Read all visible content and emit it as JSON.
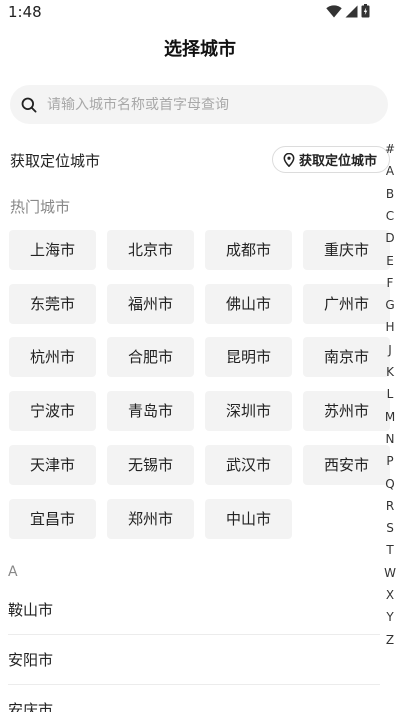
{
  "status_bar": {
    "time": "1:48"
  },
  "header": {
    "title": "选择城市"
  },
  "search": {
    "placeholder": "请输入城市名称或首字母查询"
  },
  "location": {
    "label": "获取定位城市",
    "button_label": "获取定位城市"
  },
  "hot_cities": {
    "label": "热门城市",
    "items": [
      "上海市",
      "北京市",
      "成都市",
      "重庆市",
      "东莞市",
      "福州市",
      "佛山市",
      "广州市",
      "杭州市",
      "合肥市",
      "昆明市",
      "南京市",
      "宁波市",
      "青岛市",
      "深圳市",
      "苏州市",
      "天津市",
      "无锡市",
      "武汉市",
      "西安市",
      "宜昌市",
      "郑州市",
      "中山市"
    ]
  },
  "city_groups": [
    {
      "letter": "A",
      "cities": [
        "鞍山市",
        "安阳市",
        "安庆市"
      ]
    }
  ],
  "index_bar": {
    "letters": [
      "#",
      "A",
      "B",
      "C",
      "D",
      "E",
      "F",
      "G",
      "H",
      "J",
      "K",
      "L",
      "M",
      "N",
      "P",
      "Q",
      "R",
      "S",
      "T",
      "W",
      "X",
      "Y",
      "Z"
    ]
  },
  "icons": {
    "search": "search-icon",
    "location": "location-pin-icon",
    "wifi": "wifi-icon",
    "signal": "cell-signal-icon",
    "battery": "battery-icon"
  },
  "colors": {
    "background": "#ffffff",
    "search_background": "#f4f4f4",
    "city_button_background": "#f3f3f3",
    "muted_text": "#888888"
  }
}
